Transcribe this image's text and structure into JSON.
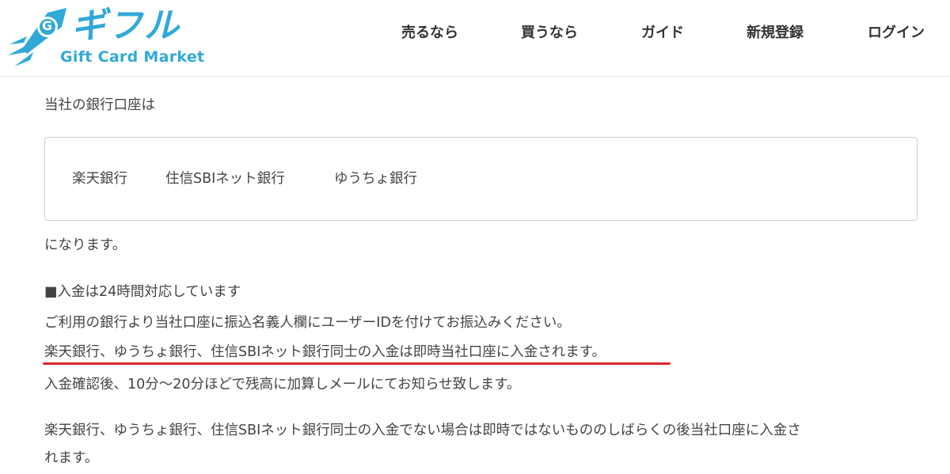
{
  "header": {
    "logo": {
      "wordmark": "ギフル",
      "tagline": "Gift Card Market",
      "mark": "G"
    },
    "nav": [
      {
        "label": "売るなら"
      },
      {
        "label": "買うなら"
      },
      {
        "label": "ガイド"
      },
      {
        "label": "新規登録"
      },
      {
        "label": "ログイン"
      }
    ]
  },
  "content": {
    "intro": "当社の銀行口座は",
    "banks": [
      "楽天銀行",
      "住信SBIネット銀行",
      "ゆうちょ銀行"
    ],
    "after_banks": "になります。",
    "deposit_heading": "■入金は24時間対応しています",
    "instruction": "ご利用の銀行より当社口座に振込名義人欄にユーザーIDを付けてお振込みください。",
    "highlight": "楽天銀行、ゆうちょ銀行、住信SBIネット銀行同士の入金は即時当社口座に入金されます。",
    "confirm": "入金確認後、10分〜20分ほどで残高に加算しメールにてお知らせ致します。",
    "other_line1": "楽天銀行、ゆうちょ銀行、住信SBIネット銀行同士の入金でない場合は即時ではないもののしばらくの後当社口座に入金さ",
    "other_line2": "れます。"
  },
  "colors": {
    "brand": "#31a9d8",
    "highlight_underline": "#e0232e",
    "text": "#444444"
  }
}
